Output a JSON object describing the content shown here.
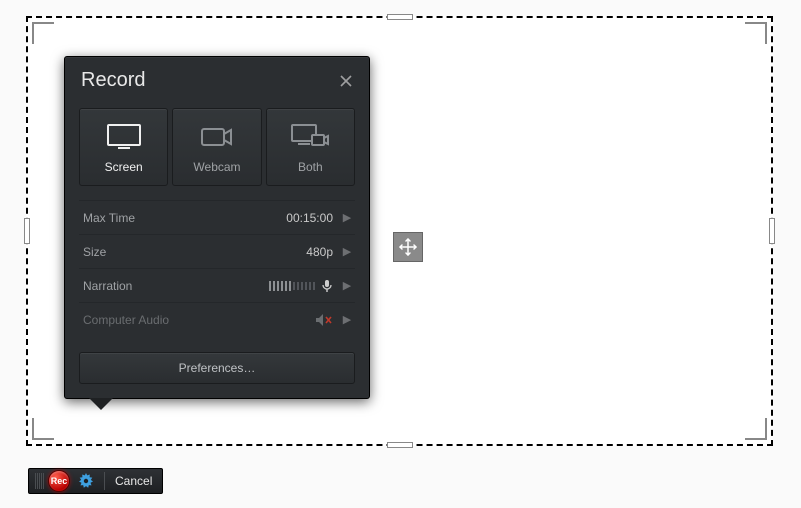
{
  "panel": {
    "title": "Record",
    "sources": {
      "screen": "Screen",
      "webcam": "Webcam",
      "both": "Both"
    },
    "settings": {
      "maxtime": {
        "label": "Max Time",
        "value": "00:15:00"
      },
      "size": {
        "label": "Size",
        "value": "480p"
      },
      "narration": {
        "label": "Narration"
      },
      "computer_audio": {
        "label": "Computer Audio"
      }
    },
    "preferences_label": "Preferences…"
  },
  "toolbar": {
    "rec_label": "Rec",
    "cancel_label": "Cancel"
  }
}
